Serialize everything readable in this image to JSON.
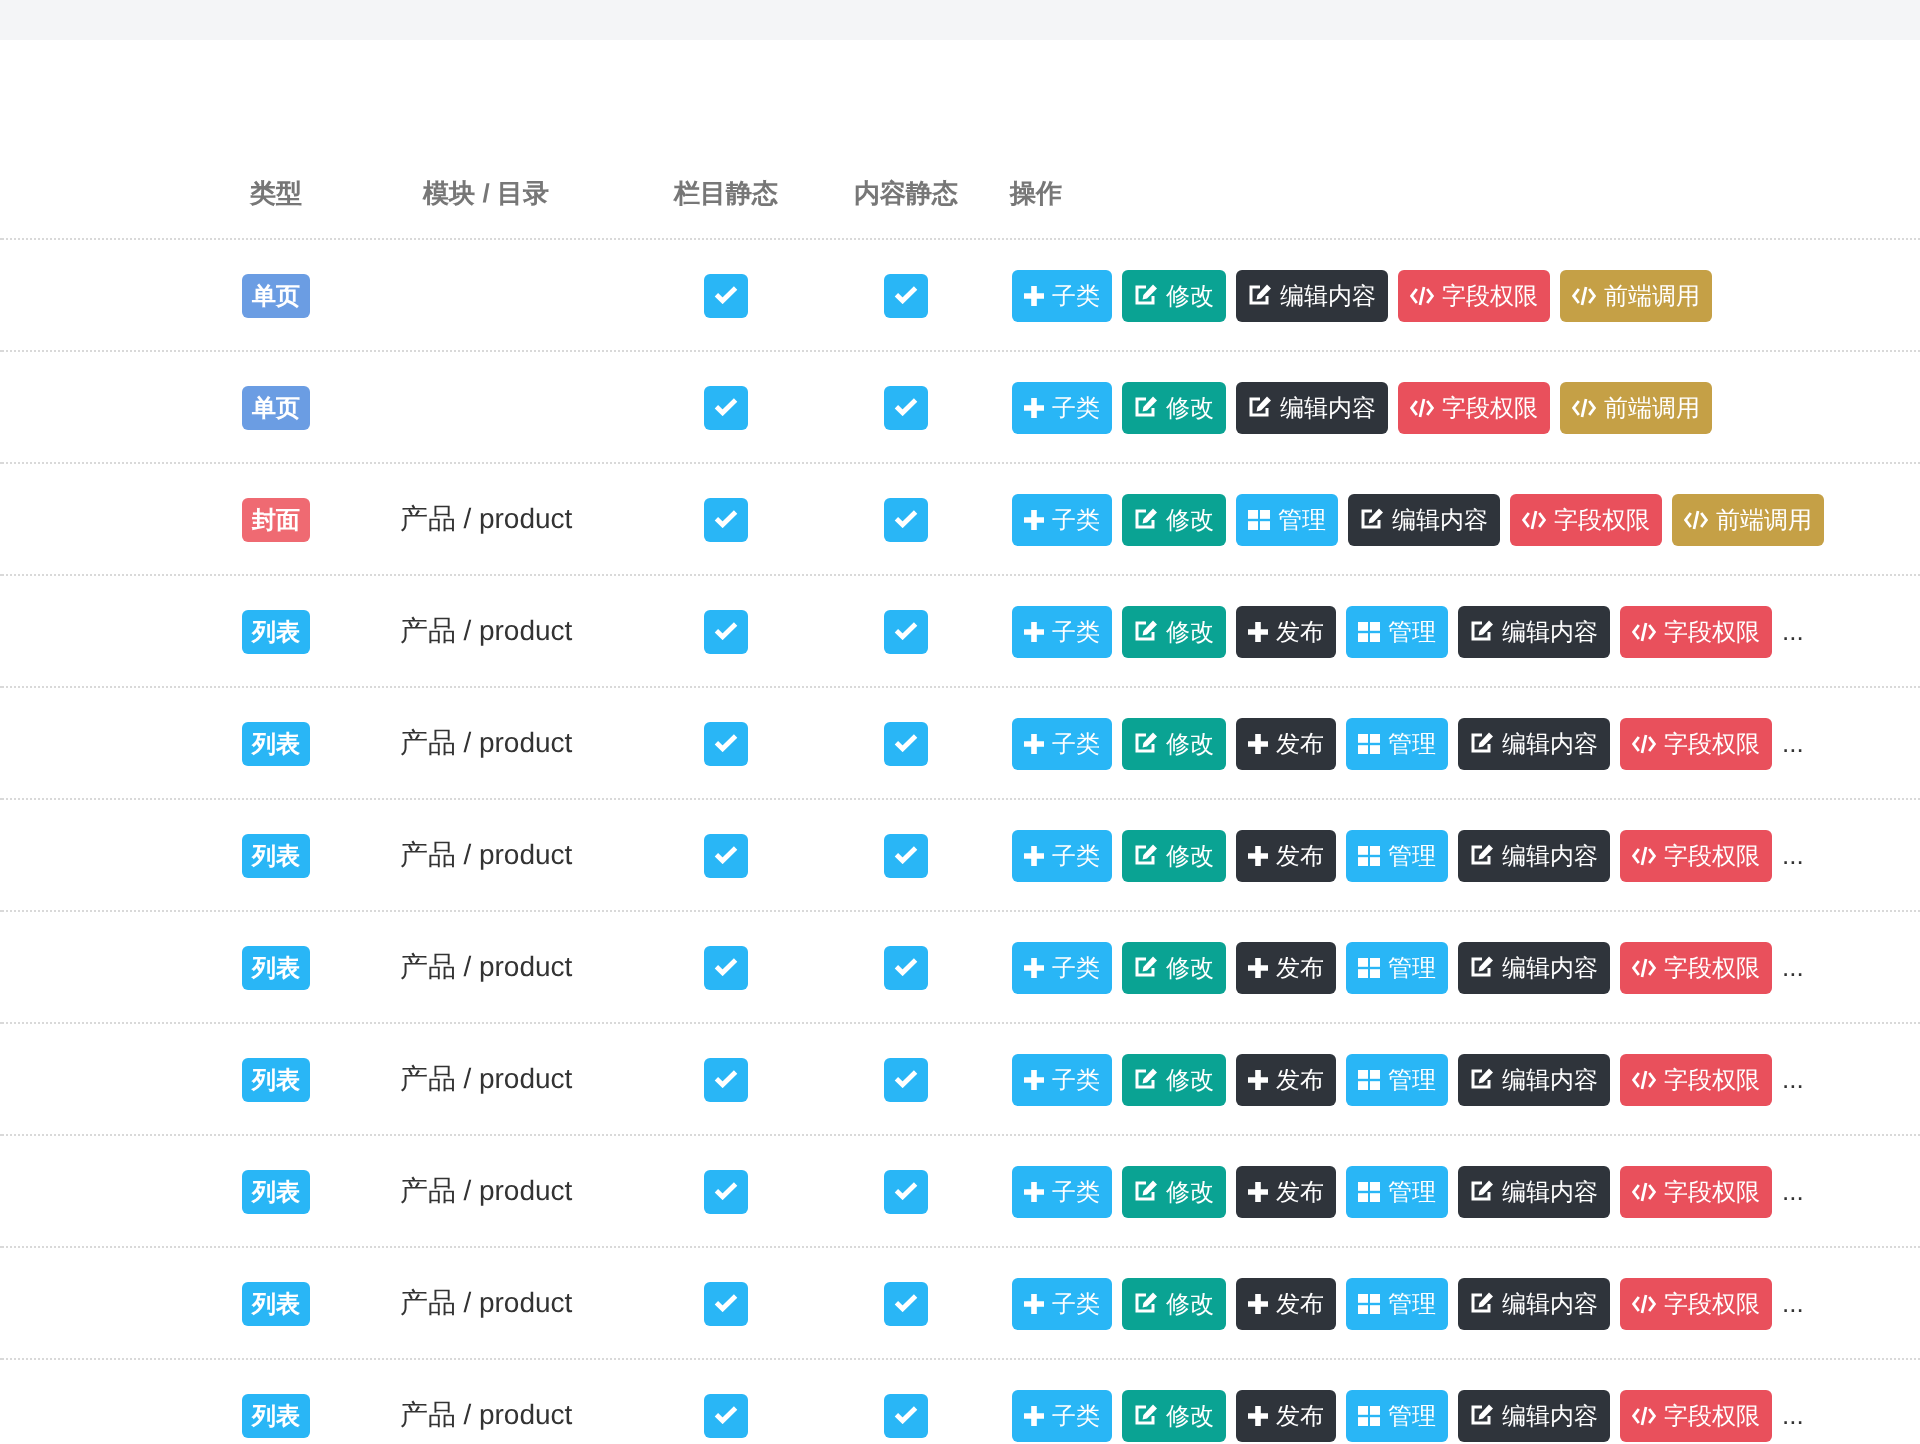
{
  "columns": [
    "类型",
    "模块 / 目录",
    "栏目静态",
    "内容静态",
    "操作"
  ],
  "rows": [
    {
      "type": {
        "label": "单页",
        "color": "#6b9de3"
      },
      "column_static": {
        "checked": true
      },
      "content_static": {
        "checked": true
      },
      "actions": [
        {
          "kind": "child",
          "label": "子类",
          "color": "#29b6f6"
        },
        {
          "kind": "edit",
          "label": "修改",
          "color": "#0aa393"
        },
        {
          "kind": "content",
          "label": "编辑内容",
          "color": "#2f343b"
        },
        {
          "kind": "fields",
          "label": "字段权限",
          "color": "#e9505c"
        },
        {
          "kind": "frontend",
          "label": "前端调用",
          "color": "#c5a046"
        }
      ]
    },
    {
      "type": {
        "label": "单页",
        "color": "#6b9de3"
      },
      "column_static": {
        "checked": true
      },
      "content_static": {
        "checked": true
      },
      "actions": [
        {
          "kind": "child",
          "label": "子类",
          "color": "#29b6f6"
        },
        {
          "kind": "edit",
          "label": "修改",
          "color": "#0aa393"
        },
        {
          "kind": "content",
          "label": "编辑内容",
          "color": "#2f343b"
        },
        {
          "kind": "fields",
          "label": "字段权限",
          "color": "#e9505c"
        },
        {
          "kind": "frontend",
          "label": "前端调用",
          "color": "#c5a046"
        }
      ]
    },
    {
      "type": {
        "label": "封面",
        "color": "#ef6a72"
      },
      "module": "产品 / product",
      "column_static": {
        "checked": true
      },
      "content_static": {
        "checked": true
      },
      "actions": [
        {
          "kind": "child",
          "label": "子类",
          "color": "#29b6f6"
        },
        {
          "kind": "edit",
          "label": "修改",
          "color": "#0aa393"
        },
        {
          "kind": "manage",
          "label": "管理",
          "color": "#29b6f6"
        },
        {
          "kind": "content",
          "label": "编辑内容",
          "color": "#2f343b"
        },
        {
          "kind": "fields",
          "label": "字段权限",
          "color": "#e9505c"
        },
        {
          "kind": "frontend",
          "label": "前端调用",
          "color": "#c5a046"
        }
      ]
    },
    {
      "type": {
        "label": "列表",
        "color": "#29b6f6"
      },
      "module": "产品 / product",
      "column_static": {
        "checked": true
      },
      "content_static": {
        "checked": true
      },
      "actions": [
        {
          "kind": "child",
          "label": "子类",
          "color": "#29b6f6"
        },
        {
          "kind": "edit",
          "label": "修改",
          "color": "#0aa393"
        },
        {
          "kind": "publish",
          "label": "发布",
          "color": "#2f343b"
        },
        {
          "kind": "manage",
          "label": "管理",
          "color": "#29b6f6"
        },
        {
          "kind": "content",
          "label": "编辑内容",
          "color": "#2f343b"
        },
        {
          "kind": "fields",
          "label": "字段权限",
          "color": "#e9505c"
        }
      ],
      "more": "..."
    },
    {
      "type": {
        "label": "列表",
        "color": "#29b6f6"
      },
      "module": "产品 / product",
      "column_static": {
        "checked": true
      },
      "content_static": {
        "checked": true
      },
      "actions": [
        {
          "kind": "child",
          "label": "子类",
          "color": "#29b6f6"
        },
        {
          "kind": "edit",
          "label": "修改",
          "color": "#0aa393"
        },
        {
          "kind": "publish",
          "label": "发布",
          "color": "#2f343b"
        },
        {
          "kind": "manage",
          "label": "管理",
          "color": "#29b6f6"
        },
        {
          "kind": "content",
          "label": "编辑内容",
          "color": "#2f343b"
        },
        {
          "kind": "fields",
          "label": "字段权限",
          "color": "#e9505c"
        }
      ],
      "more": "..."
    },
    {
      "type": {
        "label": "列表",
        "color": "#29b6f6"
      },
      "module": "产品 / product",
      "column_static": {
        "checked": true
      },
      "content_static": {
        "checked": true
      },
      "actions": [
        {
          "kind": "child",
          "label": "子类",
          "color": "#29b6f6"
        },
        {
          "kind": "edit",
          "label": "修改",
          "color": "#0aa393"
        },
        {
          "kind": "publish",
          "label": "发布",
          "color": "#2f343b"
        },
        {
          "kind": "manage",
          "label": "管理",
          "color": "#29b6f6"
        },
        {
          "kind": "content",
          "label": "编辑内容",
          "color": "#2f343b"
        },
        {
          "kind": "fields",
          "label": "字段权限",
          "color": "#e9505c"
        }
      ],
      "more": "..."
    },
    {
      "type": {
        "label": "列表",
        "color": "#29b6f6"
      },
      "module": "产品 / product",
      "column_static": {
        "checked": true
      },
      "content_static": {
        "checked": true
      },
      "actions": [
        {
          "kind": "child",
          "label": "子类",
          "color": "#29b6f6"
        },
        {
          "kind": "edit",
          "label": "修改",
          "color": "#0aa393"
        },
        {
          "kind": "publish",
          "label": "发布",
          "color": "#2f343b"
        },
        {
          "kind": "manage",
          "label": "管理",
          "color": "#29b6f6"
        },
        {
          "kind": "content",
          "label": "编辑内容",
          "color": "#2f343b"
        },
        {
          "kind": "fields",
          "label": "字段权限",
          "color": "#e9505c"
        }
      ],
      "more": "..."
    },
    {
      "type": {
        "label": "列表",
        "color": "#29b6f6"
      },
      "module": "产品 / product",
      "column_static": {
        "checked": true
      },
      "content_static": {
        "checked": true
      },
      "actions": [
        {
          "kind": "child",
          "label": "子类",
          "color": "#29b6f6"
        },
        {
          "kind": "edit",
          "label": "修改",
          "color": "#0aa393"
        },
        {
          "kind": "publish",
          "label": "发布",
          "color": "#2f343b"
        },
        {
          "kind": "manage",
          "label": "管理",
          "color": "#29b6f6"
        },
        {
          "kind": "content",
          "label": "编辑内容",
          "color": "#2f343b"
        },
        {
          "kind": "fields",
          "label": "字段权限",
          "color": "#e9505c"
        }
      ],
      "more": "..."
    },
    {
      "type": {
        "label": "列表",
        "color": "#29b6f6"
      },
      "module": "产品 / product",
      "column_static": {
        "checked": true
      },
      "content_static": {
        "checked": true
      },
      "actions": [
        {
          "kind": "child",
          "label": "子类",
          "color": "#29b6f6"
        },
        {
          "kind": "edit",
          "label": "修改",
          "color": "#0aa393"
        },
        {
          "kind": "publish",
          "label": "发布",
          "color": "#2f343b"
        },
        {
          "kind": "manage",
          "label": "管理",
          "color": "#29b6f6"
        },
        {
          "kind": "content",
          "label": "编辑内容",
          "color": "#2f343b"
        },
        {
          "kind": "fields",
          "label": "字段权限",
          "color": "#e9505c"
        }
      ],
      "more": "..."
    },
    {
      "type": {
        "label": "列表",
        "color": "#29b6f6"
      },
      "module": "产品 / product",
      "column_static": {
        "checked": true
      },
      "content_static": {
        "checked": true
      },
      "actions": [
        {
          "kind": "child",
          "label": "子类",
          "color": "#29b6f6"
        },
        {
          "kind": "edit",
          "label": "修改",
          "color": "#0aa393"
        },
        {
          "kind": "publish",
          "label": "发布",
          "color": "#2f343b"
        },
        {
          "kind": "manage",
          "label": "管理",
          "color": "#29b6f6"
        },
        {
          "kind": "content",
          "label": "编辑内容",
          "color": "#2f343b"
        },
        {
          "kind": "fields",
          "label": "字段权限",
          "color": "#e9505c"
        }
      ],
      "more": "..."
    },
    {
      "type": {
        "label": "列表",
        "color": "#29b6f6"
      },
      "module": "产品 / product",
      "column_static": {
        "checked": true
      },
      "content_static": {
        "checked": true
      },
      "actions": [
        {
          "kind": "child",
          "label": "子类",
          "color": "#29b6f6"
        },
        {
          "kind": "edit",
          "label": "修改",
          "color": "#0aa393"
        },
        {
          "kind": "publish",
          "label": "发布",
          "color": "#2f343b"
        },
        {
          "kind": "manage",
          "label": "管理",
          "color": "#29b6f6"
        },
        {
          "kind": "content",
          "label": "编辑内容",
          "color": "#2f343b"
        },
        {
          "kind": "fields",
          "label": "字段权限",
          "color": "#e9505c"
        }
      ],
      "more": "..."
    }
  ]
}
